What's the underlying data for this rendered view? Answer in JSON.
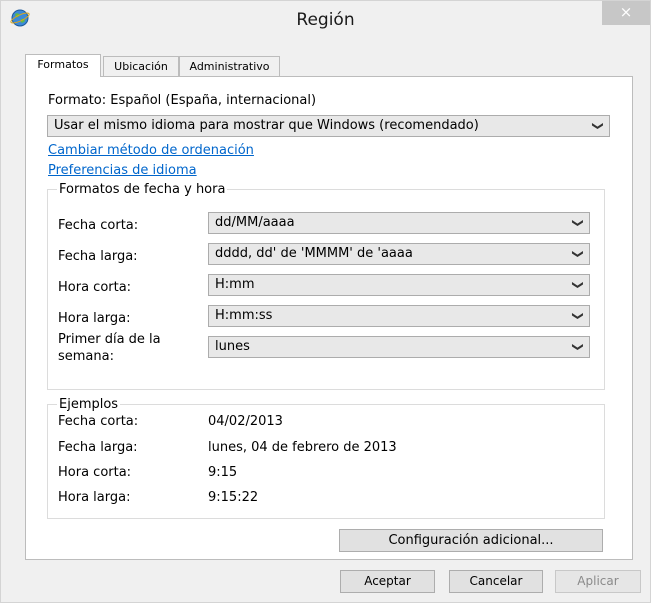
{
  "window": {
    "title": "Región",
    "close_symbol": "×"
  },
  "tabs": [
    {
      "label": "Formatos",
      "active": true
    },
    {
      "label": "Ubicación",
      "active": false
    },
    {
      "label": "Administrativo",
      "active": false
    }
  ],
  "formats": {
    "format_label": "Formato: Español (España, internacional)",
    "language_select": "Usar el mismo idioma para mostrar que Windows (recomendado)",
    "link_sort": "Cambiar método de ordenación",
    "link_language": "Preferencias de idioma"
  },
  "date_time": {
    "legend": "Formatos de fecha y hora",
    "rows": [
      {
        "label": "Fecha corta:",
        "value": "dd/MM/aaaa"
      },
      {
        "label": "Fecha larga:",
        "value": "dddd, dd' de 'MMMM' de 'aaaa"
      },
      {
        "label": "Hora corta:",
        "value": "H:mm"
      },
      {
        "label": "Hora larga:",
        "value": "H:mm:ss"
      },
      {
        "label_line1": "Primer día de la",
        "label_line2": "semana:",
        "value": "lunes"
      }
    ]
  },
  "examples": {
    "legend": "Ejemplos",
    "rows": [
      {
        "label": "Fecha corta:",
        "value": "04/02/2013"
      },
      {
        "label": "Fecha larga:",
        "value": "lunes, 04 de febrero de 2013"
      },
      {
        "label": "Hora corta:",
        "value": "9:15"
      },
      {
        "label": "Hora larga:",
        "value": "9:15:22"
      }
    ]
  },
  "buttons": {
    "additional": "Configuración adicional...",
    "ok": "Aceptar",
    "cancel": "Cancelar",
    "apply": "Aplicar"
  },
  "icons": {
    "app": "globe-icon",
    "dropdown": "chevron-down-icon"
  },
  "colors": {
    "link": "#0066cc",
    "window_bg": "#f0f0f0",
    "close_bg": "#c7c7c7"
  }
}
